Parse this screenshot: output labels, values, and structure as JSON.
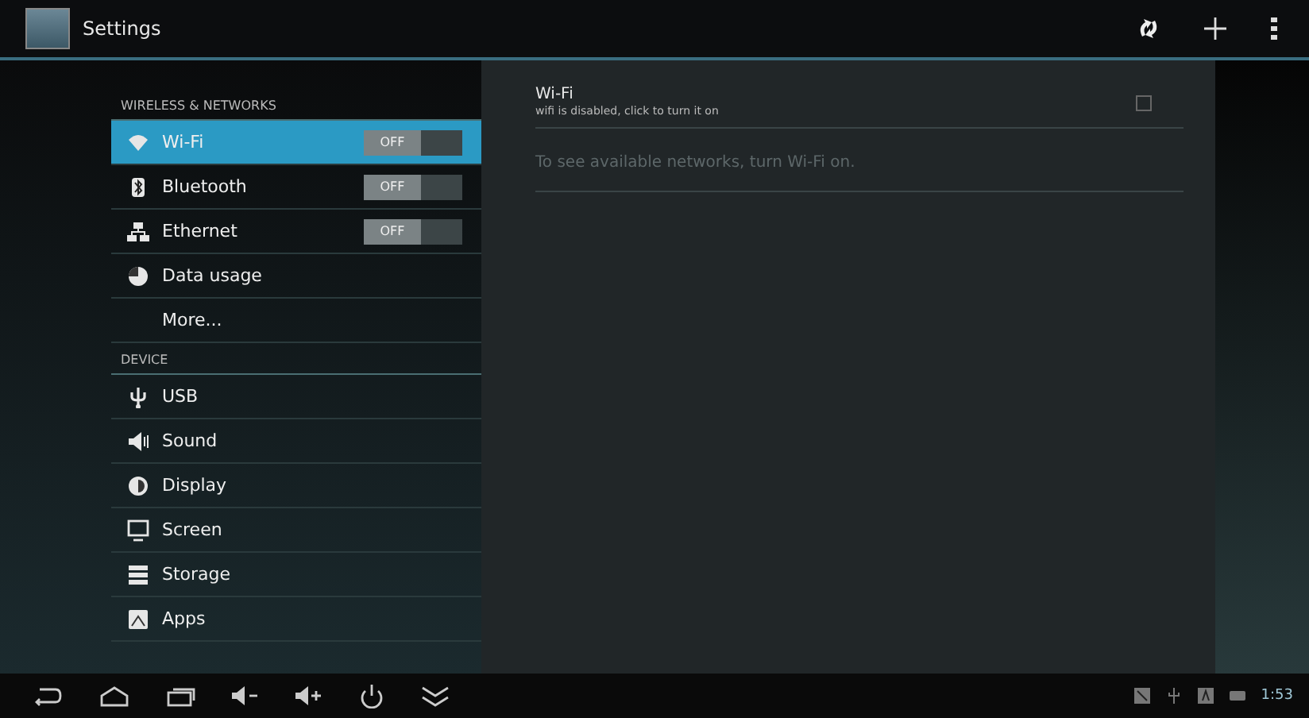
{
  "action_bar": {
    "title": "Settings"
  },
  "sections": [
    {
      "header": "WIRELESS & NETWORKS",
      "items": [
        {
          "label": "Wi-Fi",
          "kind": "toggle",
          "on": false,
          "switch_text": "OFF",
          "selected": true
        },
        {
          "label": "Bluetooth",
          "kind": "toggle",
          "on": false,
          "switch_text": "OFF",
          "selected": false
        },
        {
          "label": "Ethernet",
          "kind": "toggle",
          "on": false,
          "switch_text": "OFF",
          "selected": false
        },
        {
          "label": "Data usage",
          "kind": "plain",
          "selected": false
        },
        {
          "label": "More...",
          "kind": "plain",
          "selected": false
        }
      ]
    },
    {
      "header": "DEVICE",
      "items": [
        {
          "label": "USB",
          "kind": "plain",
          "selected": false
        },
        {
          "label": "Sound",
          "kind": "plain",
          "selected": false
        },
        {
          "label": "Display",
          "kind": "plain",
          "selected": false
        },
        {
          "label": "Screen",
          "kind": "plain",
          "selected": false
        },
        {
          "label": "Storage",
          "kind": "plain",
          "selected": false
        },
        {
          "label": "Apps",
          "kind": "plain",
          "selected": false
        }
      ]
    }
  ],
  "detail": {
    "title": "Wi-Fi",
    "subtitle": "wifi is disabled, click to turn it on",
    "checked": false,
    "message": "To see available networks, turn Wi-Fi on."
  },
  "status_bar": {
    "time": "1:53"
  }
}
